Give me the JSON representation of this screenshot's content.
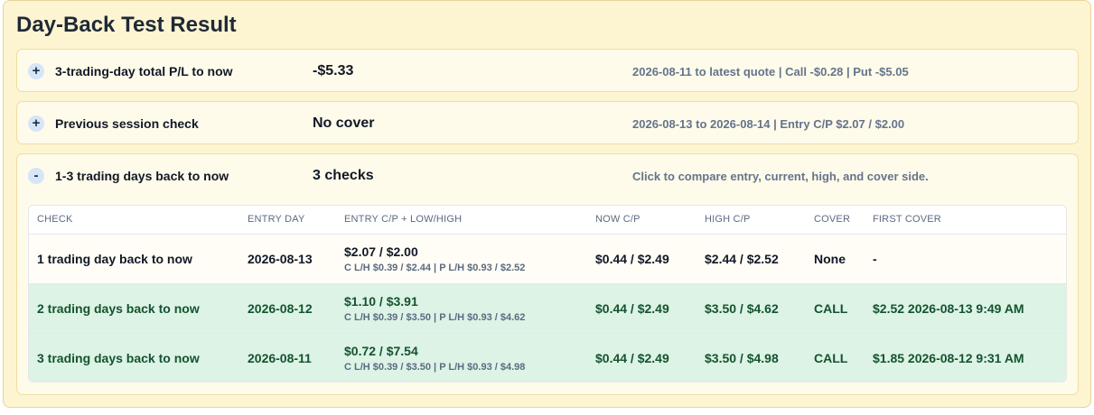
{
  "title": "Day-Back Test Result",
  "sections": [
    {
      "toggle": "+",
      "label": "3-trading-day total P/L to now",
      "value": "-$5.33",
      "meta": "2026-08-11 to latest quote | Call -$0.28 | Put -$5.05"
    },
    {
      "toggle": "+",
      "label": "Previous session check",
      "value": "No cover",
      "meta": "2026-08-13 to 2026-08-14 | Entry C/P $2.07 / $2.00"
    },
    {
      "toggle": "-",
      "label": "1-3 trading days back to now",
      "value": "3 checks",
      "meta": "Click to compare entry, current, high, and cover side."
    }
  ],
  "table": {
    "headers": [
      "Check",
      "Entry Day",
      "Entry C/P + Low/High",
      "Now C/P",
      "High C/P",
      "Cover",
      "First Cover"
    ],
    "rows": [
      {
        "check": "1 trading day back to now",
        "entry_day": "2026-08-13",
        "entry_cp": "$2.07 / $2.00",
        "low_high": "C L/H $0.39 / $2.44 | P L/H $0.93 / $2.52",
        "now_cp": "$0.44 / $2.49",
        "high_cp": "$2.44 / $2.52",
        "cover": "None",
        "first_cover": "-"
      },
      {
        "check": "2 trading days back to now",
        "entry_day": "2026-08-12",
        "entry_cp": "$1.10 / $3.91",
        "low_high": "C L/H $0.39 / $3.50 | P L/H $0.93 / $4.62",
        "now_cp": "$0.44 / $2.49",
        "high_cp": "$3.50 / $4.62",
        "cover": "CALL",
        "first_cover": "$2.52 2026-08-13 9:49 AM"
      },
      {
        "check": "3 trading days back to now",
        "entry_day": "2026-08-11",
        "entry_cp": "$0.72 / $7.54",
        "low_high": "C L/H $0.39 / $3.50 | P L/H $0.93 / $4.98",
        "now_cp": "$0.44 / $2.49",
        "high_cp": "$3.50 / $4.98",
        "cover": "CALL",
        "first_cover": "$1.85 2026-08-12 9:31 AM"
      }
    ]
  },
  "colors": {
    "panel_bg": "#fdf5d2",
    "covered_row_bg": "#dcf3e6",
    "covered_row_text": "#14532d",
    "meta_text": "#64748b"
  }
}
